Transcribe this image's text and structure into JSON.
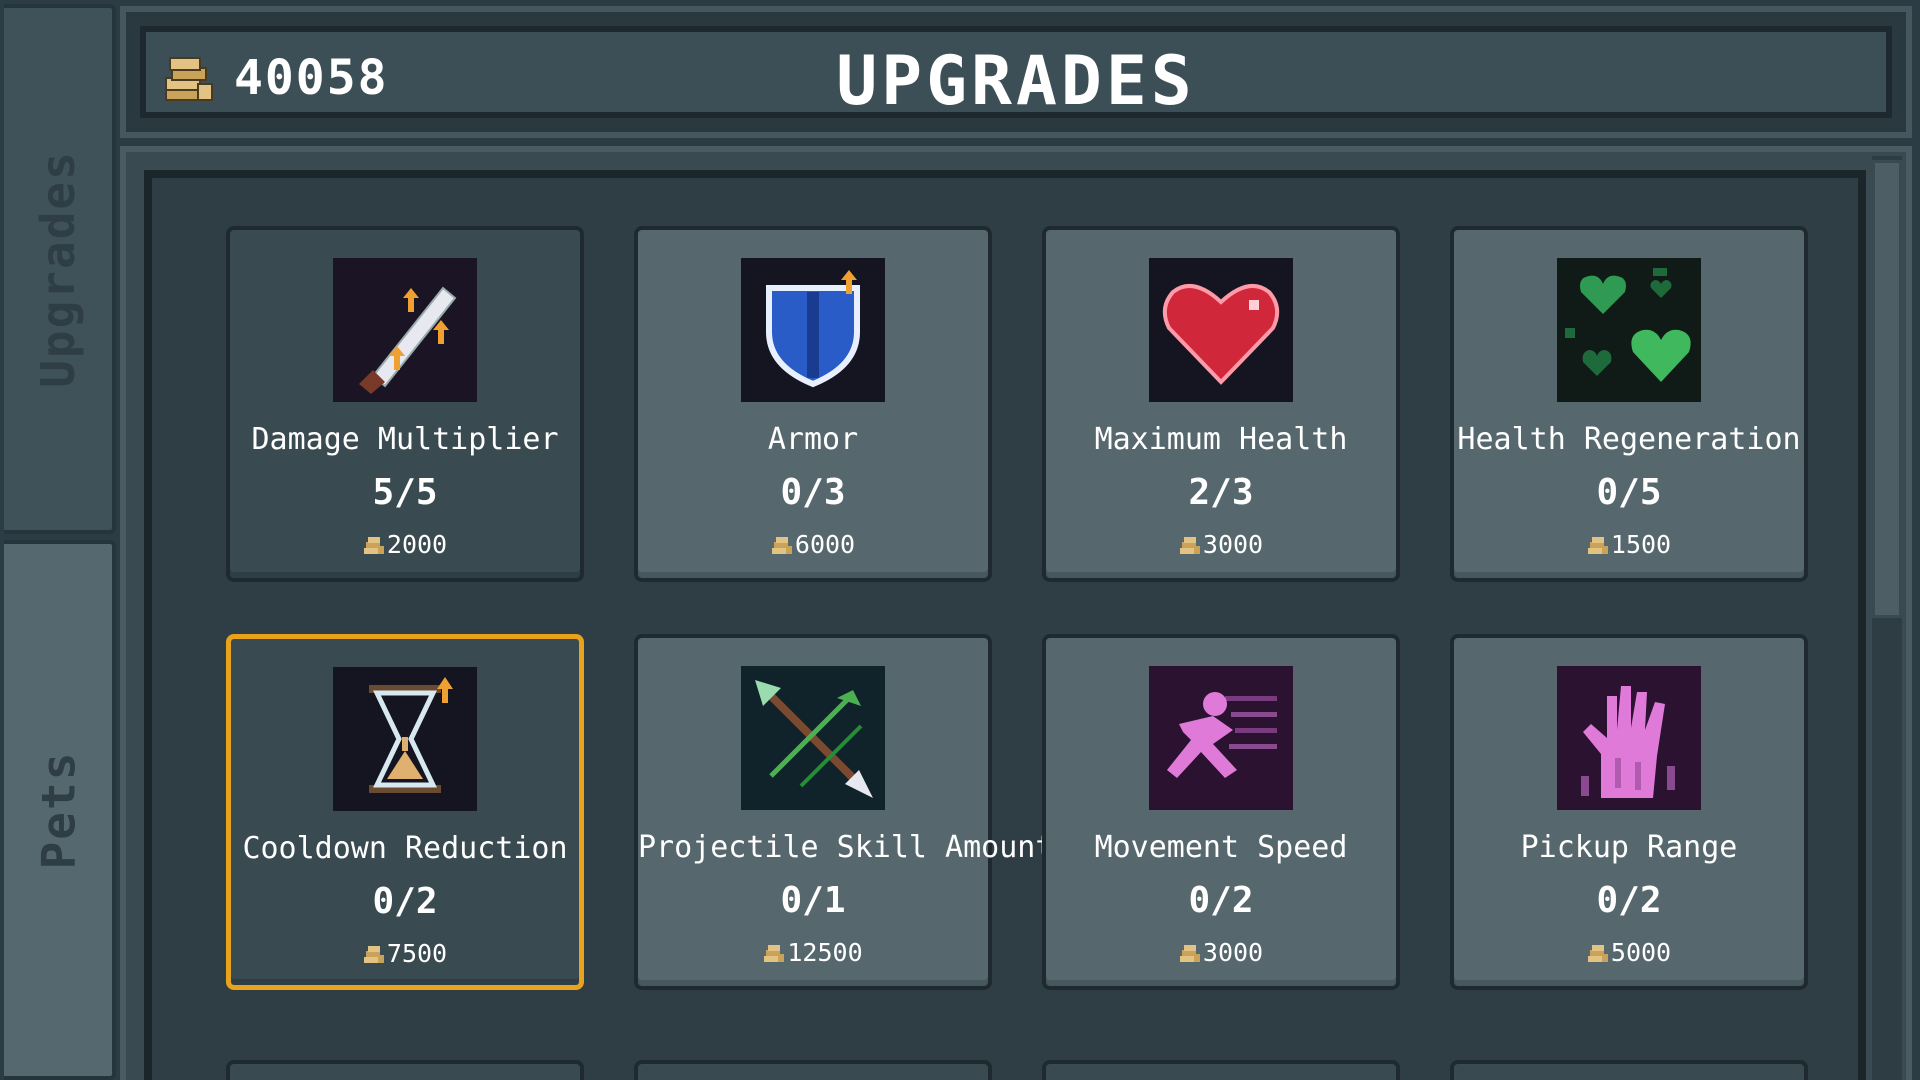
{
  "header": {
    "coins": "40058",
    "title": "UPGRADES"
  },
  "side_tabs": [
    {
      "label": "Upgrades",
      "active": false
    },
    {
      "label": "Pets",
      "active": true
    }
  ],
  "upgrades": [
    {
      "name": "Damage Multiplier",
      "level": "5/5",
      "cost": "2000",
      "icon": "sword-up-icon"
    },
    {
      "name": "Armor",
      "level": "0/3",
      "cost": "6000",
      "icon": "shield-icon"
    },
    {
      "name": "Maximum Health",
      "level": "2/3",
      "cost": "3000",
      "icon": "heart-icon"
    },
    {
      "name": "Health Regeneration",
      "level": "0/5",
      "cost": "1500",
      "icon": "green-hearts-icon"
    },
    {
      "name": "Cooldown Reduction",
      "level": "0/2",
      "cost": "7500",
      "icon": "hourglass-icon",
      "selected": true
    },
    {
      "name": "Projectile Skill Amount",
      "level": "0/1",
      "cost": "12500",
      "icon": "arrows-icon"
    },
    {
      "name": "Movement Speed",
      "level": "0/2",
      "cost": "3000",
      "icon": "running-figure-icon"
    },
    {
      "name": "Pickup Range",
      "level": "0/2",
      "cost": "5000",
      "icon": "magnet-hand-icon"
    }
  ],
  "colors": {
    "selected_border": "#e8a21c",
    "card": "#56686e",
    "panel": "#2f3e45"
  }
}
